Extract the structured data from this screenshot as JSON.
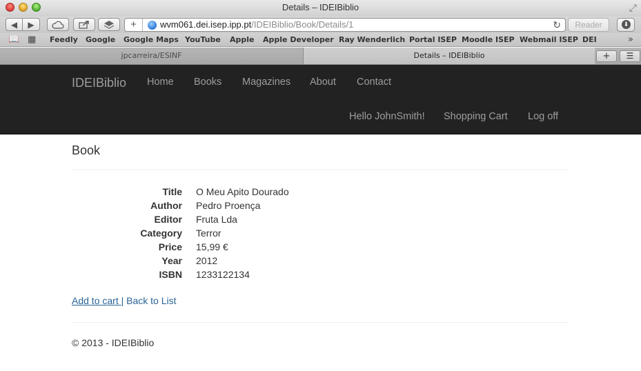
{
  "window": {
    "title": "Details – IDEIBiblio"
  },
  "address_bar": {
    "host": "wvm061.dei.isep.ipp.pt",
    "path": "/IDEIBiblio/Book/Details/1",
    "reader_label": "Reader"
  },
  "bookmarks": [
    "Feedly",
    "Google",
    "Google Maps",
    "YouTube",
    "Apple",
    "Apple Developer",
    "Ray Wenderlich",
    "Portal ISEP",
    "Moodle ISEP",
    "Webmail ISEP",
    "DEI"
  ],
  "tabs": [
    {
      "label": "jpcarreira/ESINF",
      "active": false
    },
    {
      "label": "Details – IDEIBiblio",
      "active": true
    }
  ],
  "navbar": {
    "brand": "IDEIBiblio",
    "links": [
      "Home",
      "Books",
      "Magazines",
      "About",
      "Contact"
    ],
    "greeting": "Hello JohnSmith!",
    "cart": "Shopping Cart",
    "logoff": "Log off"
  },
  "page": {
    "heading": "Book",
    "details": [
      {
        "label": "Title",
        "value": "O Meu Apito Dourado"
      },
      {
        "label": "Author",
        "value": "Pedro Proença"
      },
      {
        "label": "Editor",
        "value": "Fruta Lda"
      },
      {
        "label": "Category",
        "value": "Terror"
      },
      {
        "label": "Price",
        "value": "15,99 €"
      },
      {
        "label": "Year",
        "value": "2012"
      },
      {
        "label": "ISBN",
        "value": "1233122134"
      }
    ],
    "add_to_cart": "Add to cart",
    "separator": "|",
    "back_to_list": "Back to List",
    "footer": "© 2013 - IDEIBiblio"
  }
}
